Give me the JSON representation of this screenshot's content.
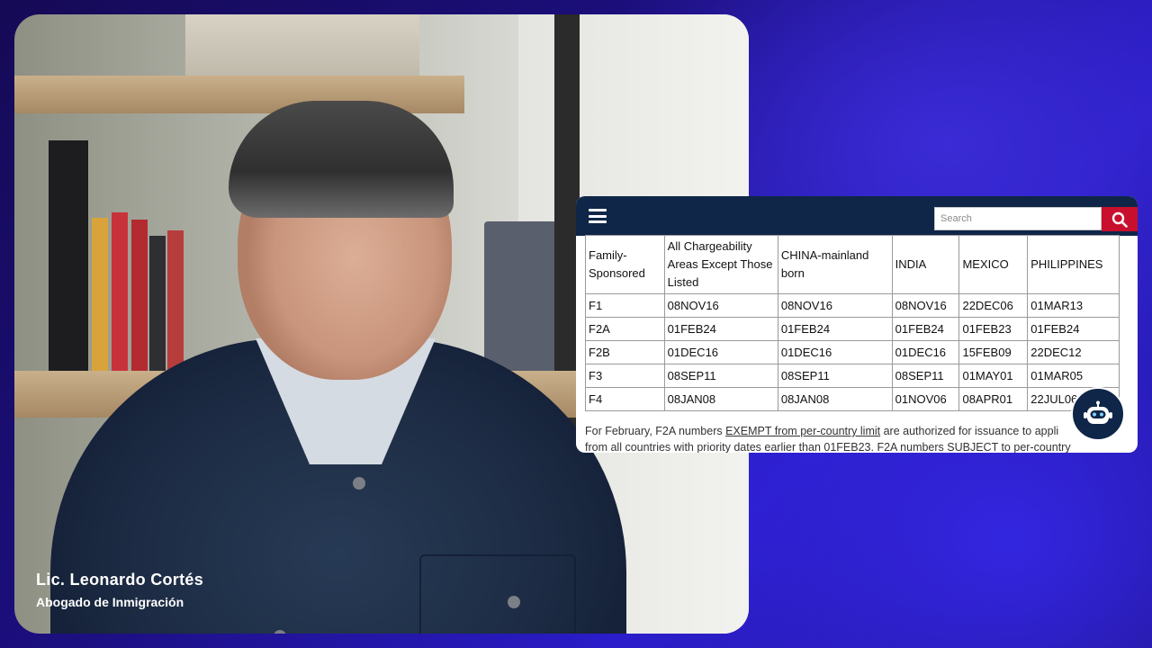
{
  "video": {
    "speaker_name": "Lic. Leonardo Cortés",
    "speaker_title": "Abogado de Inmigración"
  },
  "website": {
    "search": {
      "placeholder": "Search"
    },
    "icons": {
      "menu": "hamburger-menu-icon",
      "search": "magnifier-icon",
      "chatbot": "robot-icon"
    },
    "colors": {
      "header": "#0f2648",
      "search_button": "#c8102e"
    },
    "table": {
      "headers": [
        "Family-Sponsored",
        "All Chargeability Areas Except Those Listed",
        "CHINA-mainland born",
        "INDIA",
        "MEXICO",
        "PHILIPPINES"
      ],
      "rows": [
        [
          "F1",
          "08NOV16",
          "08NOV16",
          "08NOV16",
          "22DEC06",
          "01MAR13"
        ],
        [
          "F2A",
          "01FEB24",
          "01FEB24",
          "01FEB24",
          "01FEB23",
          "01FEB24"
        ],
        [
          "F2B",
          "01DEC16",
          "01DEC16",
          "01DEC16",
          "15FEB09",
          "22DEC12"
        ],
        [
          "F3",
          "08SEP11",
          "08SEP11",
          "08SEP11",
          "01MAY01",
          "01MAR05"
        ],
        [
          "F4",
          "08JAN08",
          "08JAN08",
          "01NOV06",
          "08APR01",
          "22JUL06"
        ]
      ]
    },
    "footnote": {
      "prefix": "For February, F2A numbers ",
      "link": "EXEMPT from per-country limit",
      "suffix": " are authorized for issuance to appli",
      "line2": "from all countries with priority dates earlier than 01FEB23. F2A numbers SUBJECT to per-country"
    }
  }
}
